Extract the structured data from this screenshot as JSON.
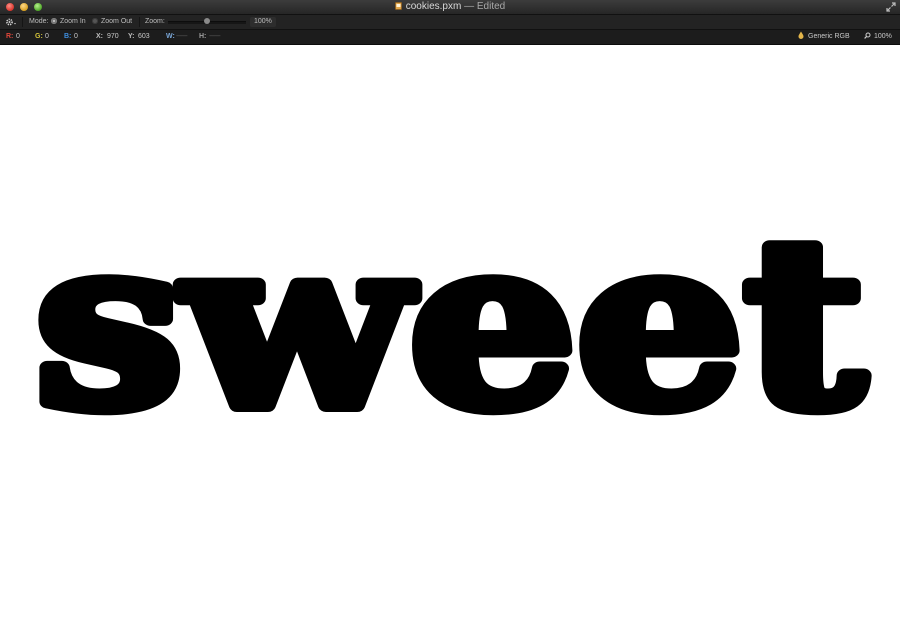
{
  "window": {
    "title": "cookies.pxm",
    "status": "— Edited"
  },
  "toolbar": {
    "mode_label": "Mode:",
    "zoom_in_label": "Zoom In",
    "zoom_out_label": "Zoom Out",
    "zoom_label": "Zoom:",
    "zoom_value": "100%",
    "zoom_slider_level": 0.5,
    "selected_mode": "zoom-in"
  },
  "infobar": {
    "r_label": "R:",
    "r_value": "0",
    "g_label": "G:",
    "g_value": "0",
    "b_label": "B:",
    "b_value": "0",
    "x_label": "X:",
    "x_value": "970",
    "y_label": "Y:",
    "y_value": "603",
    "w_label": "W:",
    "w_value": "--------",
    "h_label": "H:",
    "h_value": "--------",
    "color_profile": "Generic RGB",
    "zoom_value": "100%"
  },
  "canvas": {
    "text": "sweet",
    "text_color": "#000000",
    "background": "#ffffff"
  },
  "colors": {
    "r_accent": "#e0473a",
    "g_accent": "#d4c43a",
    "b_accent": "#3f8fe0",
    "w_accent": "#7aa7d8",
    "h_accent": "#a0a0a0"
  },
  "icons": {
    "doc": "document-icon",
    "fullscreen": "fullscreen-icon",
    "gear": "gear-icon",
    "profile": "color-profile-icon",
    "zoom": "magnifier-icon"
  }
}
